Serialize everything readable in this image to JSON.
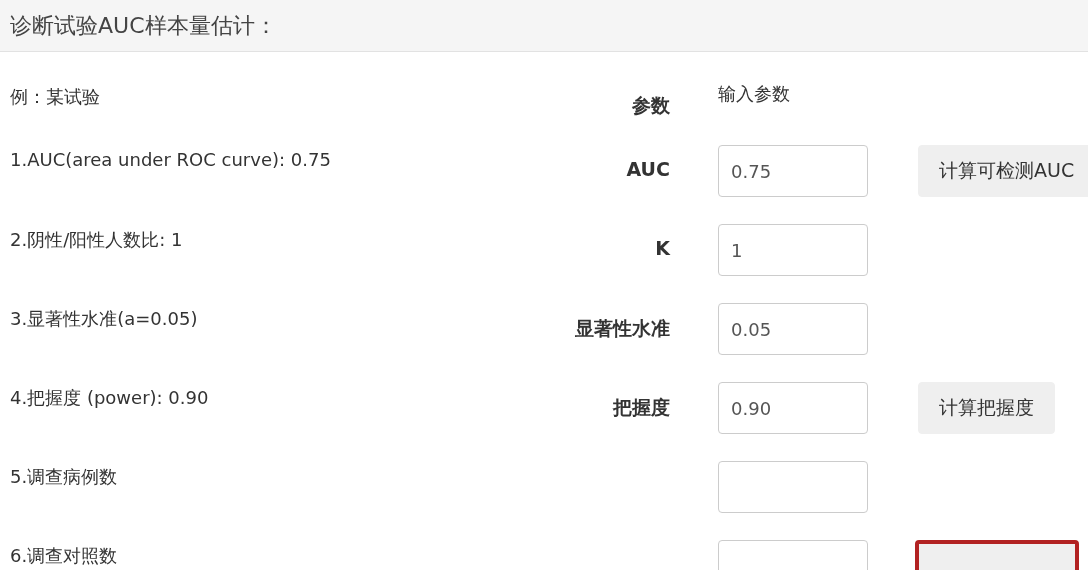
{
  "title": "诊断试验AUC样本量估计：",
  "header": {
    "example": "例：某试验",
    "param": "参数",
    "input": "输入参数"
  },
  "rows": [
    {
      "example": "1.AUC(area under ROC curve): 0.75",
      "label": "AUC",
      "value": "0.75",
      "button": {
        "label": "计算可检测AUC",
        "highlighted": false
      }
    },
    {
      "example": "2.阴性/阳性人数比: 1",
      "label": "K",
      "value": "1"
    },
    {
      "example": "3.显著性水准(a=0.05)",
      "label": "显著性水准",
      "value": "0.05"
    },
    {
      "example": "4.把握度 (power): 0.90",
      "label": "把握度",
      "value": "0.90",
      "button": {
        "label": "计算把握度",
        "highlighted": false
      }
    },
    {
      "example": "5.调查病例数",
      "value": ""
    },
    {
      "example": "6.调查对照数",
      "value": "",
      "button": {
        "highlighted": true
      }
    }
  ]
}
